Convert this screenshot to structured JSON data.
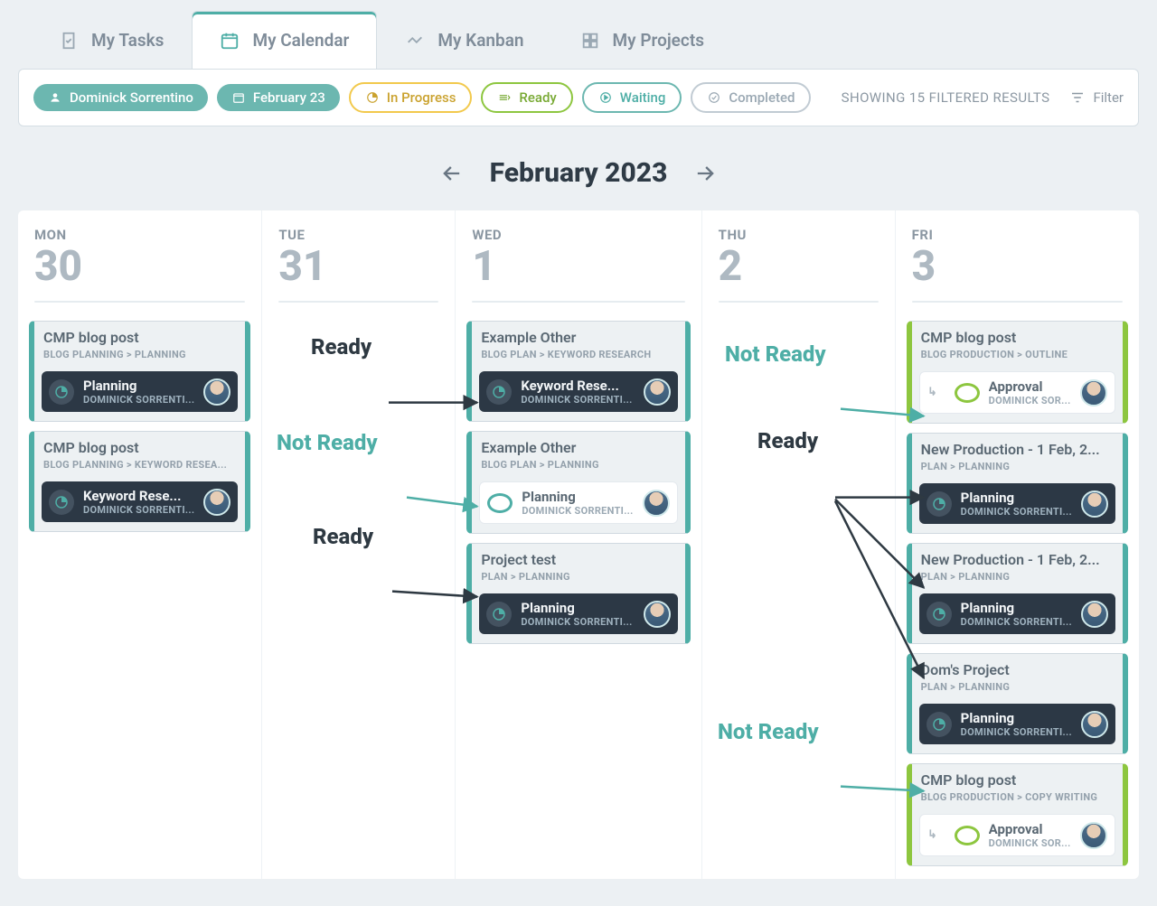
{
  "tabs": {
    "tasks": "My Tasks",
    "calendar": "My Calendar",
    "kanban": "My Kanban",
    "projects": "My Projects",
    "active": "calendar"
  },
  "filters": {
    "user": "Dominick Sorrentino",
    "date": "February 23",
    "in_progress": "In Progress",
    "ready": "Ready",
    "waiting": "Waiting",
    "completed": "Completed",
    "results": "SHOWING 15 FILTERED RESULTS",
    "filter_btn": "Filter"
  },
  "month_nav": {
    "title": "February 2023"
  },
  "columns": [
    {
      "dow": "MON",
      "num": "30",
      "cards": [
        {
          "accent": "teal",
          "title": "CMP blog post",
          "crumb": "BLOG PLANNING > PLANNING",
          "task": {
            "style": "dark",
            "name": "Planning",
            "assignee": "DOMINICK SORRENTI..."
          }
        },
        {
          "accent": "teal",
          "title": "CMP blog post",
          "crumb": "BLOG PLANNING > KEYWORD RESEA...",
          "task": {
            "style": "dark",
            "name": "Keyword Rese...",
            "assignee": "DOMINICK SORRENTI..."
          }
        }
      ]
    },
    {
      "dow": "TUE",
      "num": "31",
      "cards": []
    },
    {
      "dow": "WED",
      "num": "1",
      "cards": [
        {
          "accent": "teal",
          "title": "Example Other",
          "crumb": "BLOG PLAN > KEYWORD RESEARCH",
          "task": {
            "style": "dark",
            "name": "Keyword Rese...",
            "assignee": "DOMINICK SORRENTI..."
          }
        },
        {
          "accent": "teal",
          "title": "Example Other",
          "crumb": "BLOG PLAN > PLANNING",
          "task": {
            "style": "light-teal",
            "name": "Planning",
            "assignee": "DOMINICK SORRENTI..."
          }
        },
        {
          "accent": "teal",
          "title": "Project test",
          "crumb": "PLAN > PLANNING",
          "task": {
            "style": "dark",
            "name": "Planning",
            "assignee": "DOMINICK SORRENTI..."
          }
        }
      ]
    },
    {
      "dow": "THU",
      "num": "2",
      "cards": []
    },
    {
      "dow": "FRI",
      "num": "3",
      "cards": [
        {
          "accent": "lime",
          "title": "CMP blog post",
          "crumb": "BLOG PRODUCTION > OUTLINE",
          "task": {
            "style": "light-green",
            "dep": true,
            "name": "Approval",
            "assignee": "DOMINICK SOR..."
          }
        },
        {
          "accent": "teal",
          "title": "New Production - 1 Feb, 2...",
          "crumb": "PLAN > PLANNING",
          "task": {
            "style": "dark",
            "name": "Planning",
            "assignee": "DOMINICK SORRENTI..."
          }
        },
        {
          "accent": "teal",
          "title": "New Production - 1 Feb, 2...",
          "crumb": "PLAN > PLANNING",
          "task": {
            "style": "dark",
            "name": "Planning",
            "assignee": "DOMINICK SORRENTI..."
          }
        },
        {
          "accent": "teal",
          "title": "Dom's Project",
          "crumb": "PLAN > PLANNING",
          "task": {
            "style": "dark",
            "name": "Planning",
            "assignee": "DOMINICK SORRENTI..."
          }
        },
        {
          "accent": "lime",
          "title": "CMP blog post",
          "crumb": "BLOG PRODUCTION > COPY WRITING",
          "task": {
            "style": "light-green",
            "dep": true,
            "name": "Approval",
            "assignee": "DOMINICK SOR..."
          }
        }
      ]
    }
  ],
  "annotations": {
    "ready1": "Ready",
    "notready1": "Not Ready",
    "ready2": "Ready",
    "notready2": "Not Ready",
    "ready3": "Ready",
    "notready3": "Not Ready"
  }
}
